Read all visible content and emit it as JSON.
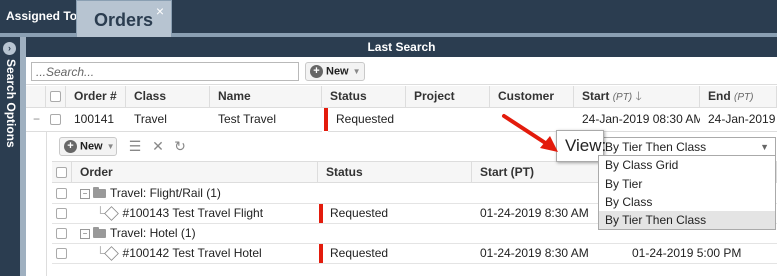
{
  "tabs": [
    {
      "label": "Assigned To M"
    },
    {
      "label": "Orders",
      "close": "×"
    }
  ],
  "sidebar": {
    "label": "Search Options"
  },
  "last_search": {
    "title": "Last Search"
  },
  "search": {
    "placeholder": "...Search...",
    "value": ""
  },
  "toolbar": {
    "new_label": "New"
  },
  "grid": {
    "columns": [
      "Order #",
      "Class",
      "Name",
      "Status",
      "Project",
      "Customer",
      "Start",
      "End"
    ],
    "start_suffix": "(PT)",
    "end_suffix": "(PT)",
    "row": {
      "expand": "−",
      "order": "100141",
      "class": "Travel",
      "name": "Test Travel",
      "status": "Requested",
      "project": "",
      "customer": "",
      "start": "24-Jan-2019 08:30 AM",
      "end": "24-Jan-2019 05:0"
    }
  },
  "subgrid": {
    "new_label": "New",
    "columns": [
      "Order",
      "Status",
      "Start (PT)"
    ],
    "rows": [
      {
        "type": "group",
        "label": "Travel: Flight/Rail (1)"
      },
      {
        "type": "item",
        "label": "#100143 Test Travel Flight",
        "status": "Requested",
        "start": "01-24-2019 8:30 AM",
        "end": ""
      },
      {
        "type": "group",
        "label": "Travel: Hotel (1)"
      },
      {
        "type": "item",
        "label": "#100142 Test Travel Hotel",
        "status": "Requested",
        "start": "01-24-2019 8:30 AM",
        "end": "01-24-2019 5:00 PM"
      }
    ]
  },
  "view": {
    "label": "View:",
    "selected": "By Tier Then Class",
    "options": [
      "By Class Grid",
      "By Tier",
      "By Class",
      "By Tier Then Class"
    ]
  },
  "colors": {
    "accent": "#2b3d50",
    "status": "#e31b0c"
  }
}
